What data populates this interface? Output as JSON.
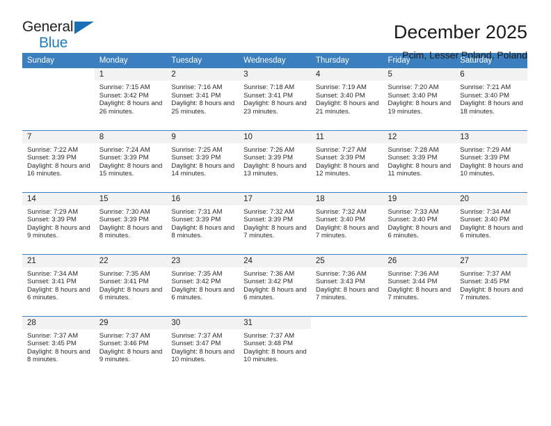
{
  "brand": {
    "name_part1": "General",
    "name_part2": "Blue",
    "flag_icon": "triangle-flag-icon",
    "accent_color": "#1a7fc1"
  },
  "header": {
    "title": "December 2025",
    "subtitle": "Pcim, Lesser Poland, Poland"
  },
  "calendar": {
    "header_bg_color": "#3b7fbe",
    "daynum_bg_color": "#f2f2f2",
    "weekday_headers": [
      "Sunday",
      "Monday",
      "Tuesday",
      "Wednesday",
      "Thursday",
      "Friday",
      "Saturday"
    ],
    "weeks": [
      [
        {
          "day": "",
          "sunrise": "",
          "sunset": "",
          "daylight": ""
        },
        {
          "day": "1",
          "sunrise": "Sunrise: 7:15 AM",
          "sunset": "Sunset: 3:42 PM",
          "daylight": "Daylight: 8 hours and 26 minutes."
        },
        {
          "day": "2",
          "sunrise": "Sunrise: 7:16 AM",
          "sunset": "Sunset: 3:41 PM",
          "daylight": "Daylight: 8 hours and 25 minutes."
        },
        {
          "day": "3",
          "sunrise": "Sunrise: 7:18 AM",
          "sunset": "Sunset: 3:41 PM",
          "daylight": "Daylight: 8 hours and 23 minutes."
        },
        {
          "day": "4",
          "sunrise": "Sunrise: 7:19 AM",
          "sunset": "Sunset: 3:40 PM",
          "daylight": "Daylight: 8 hours and 21 minutes."
        },
        {
          "day": "5",
          "sunrise": "Sunrise: 7:20 AM",
          "sunset": "Sunset: 3:40 PM",
          "daylight": "Daylight: 8 hours and 19 minutes."
        },
        {
          "day": "6",
          "sunrise": "Sunrise: 7:21 AM",
          "sunset": "Sunset: 3:40 PM",
          "daylight": "Daylight: 8 hours and 18 minutes."
        }
      ],
      [
        {
          "day": "7",
          "sunrise": "Sunrise: 7:22 AM",
          "sunset": "Sunset: 3:39 PM",
          "daylight": "Daylight: 8 hours and 16 minutes."
        },
        {
          "day": "8",
          "sunrise": "Sunrise: 7:24 AM",
          "sunset": "Sunset: 3:39 PM",
          "daylight": "Daylight: 8 hours and 15 minutes."
        },
        {
          "day": "9",
          "sunrise": "Sunrise: 7:25 AM",
          "sunset": "Sunset: 3:39 PM",
          "daylight": "Daylight: 8 hours and 14 minutes."
        },
        {
          "day": "10",
          "sunrise": "Sunrise: 7:26 AM",
          "sunset": "Sunset: 3:39 PM",
          "daylight": "Daylight: 8 hours and 13 minutes."
        },
        {
          "day": "11",
          "sunrise": "Sunrise: 7:27 AM",
          "sunset": "Sunset: 3:39 PM",
          "daylight": "Daylight: 8 hours and 12 minutes."
        },
        {
          "day": "12",
          "sunrise": "Sunrise: 7:28 AM",
          "sunset": "Sunset: 3:39 PM",
          "daylight": "Daylight: 8 hours and 11 minutes."
        },
        {
          "day": "13",
          "sunrise": "Sunrise: 7:29 AM",
          "sunset": "Sunset: 3:39 PM",
          "daylight": "Daylight: 8 hours and 10 minutes."
        }
      ],
      [
        {
          "day": "14",
          "sunrise": "Sunrise: 7:29 AM",
          "sunset": "Sunset: 3:39 PM",
          "daylight": "Daylight: 8 hours and 9 minutes."
        },
        {
          "day": "15",
          "sunrise": "Sunrise: 7:30 AM",
          "sunset": "Sunset: 3:39 PM",
          "daylight": "Daylight: 8 hours and 8 minutes."
        },
        {
          "day": "16",
          "sunrise": "Sunrise: 7:31 AM",
          "sunset": "Sunset: 3:39 PM",
          "daylight": "Daylight: 8 hours and 8 minutes."
        },
        {
          "day": "17",
          "sunrise": "Sunrise: 7:32 AM",
          "sunset": "Sunset: 3:39 PM",
          "daylight": "Daylight: 8 hours and 7 minutes."
        },
        {
          "day": "18",
          "sunrise": "Sunrise: 7:32 AM",
          "sunset": "Sunset: 3:40 PM",
          "daylight": "Daylight: 8 hours and 7 minutes."
        },
        {
          "day": "19",
          "sunrise": "Sunrise: 7:33 AM",
          "sunset": "Sunset: 3:40 PM",
          "daylight": "Daylight: 8 hours and 6 minutes."
        },
        {
          "day": "20",
          "sunrise": "Sunrise: 7:34 AM",
          "sunset": "Sunset: 3:40 PM",
          "daylight": "Daylight: 8 hours and 6 minutes."
        }
      ],
      [
        {
          "day": "21",
          "sunrise": "Sunrise: 7:34 AM",
          "sunset": "Sunset: 3:41 PM",
          "daylight": "Daylight: 8 hours and 6 minutes."
        },
        {
          "day": "22",
          "sunrise": "Sunrise: 7:35 AM",
          "sunset": "Sunset: 3:41 PM",
          "daylight": "Daylight: 8 hours and 6 minutes."
        },
        {
          "day": "23",
          "sunrise": "Sunrise: 7:35 AM",
          "sunset": "Sunset: 3:42 PM",
          "daylight": "Daylight: 8 hours and 6 minutes."
        },
        {
          "day": "24",
          "sunrise": "Sunrise: 7:36 AM",
          "sunset": "Sunset: 3:42 PM",
          "daylight": "Daylight: 8 hours and 6 minutes."
        },
        {
          "day": "25",
          "sunrise": "Sunrise: 7:36 AM",
          "sunset": "Sunset: 3:43 PM",
          "daylight": "Daylight: 8 hours and 7 minutes."
        },
        {
          "day": "26",
          "sunrise": "Sunrise: 7:36 AM",
          "sunset": "Sunset: 3:44 PM",
          "daylight": "Daylight: 8 hours and 7 minutes."
        },
        {
          "day": "27",
          "sunrise": "Sunrise: 7:37 AM",
          "sunset": "Sunset: 3:45 PM",
          "daylight": "Daylight: 8 hours and 7 minutes."
        }
      ],
      [
        {
          "day": "28",
          "sunrise": "Sunrise: 7:37 AM",
          "sunset": "Sunset: 3:45 PM",
          "daylight": "Daylight: 8 hours and 8 minutes."
        },
        {
          "day": "29",
          "sunrise": "Sunrise: 7:37 AM",
          "sunset": "Sunset: 3:46 PM",
          "daylight": "Daylight: 8 hours and 9 minutes."
        },
        {
          "day": "30",
          "sunrise": "Sunrise: 7:37 AM",
          "sunset": "Sunset: 3:47 PM",
          "daylight": "Daylight: 8 hours and 10 minutes."
        },
        {
          "day": "31",
          "sunrise": "Sunrise: 7:37 AM",
          "sunset": "Sunset: 3:48 PM",
          "daylight": "Daylight: 8 hours and 10 minutes."
        },
        {
          "day": "",
          "sunrise": "",
          "sunset": "",
          "daylight": ""
        },
        {
          "day": "",
          "sunrise": "",
          "sunset": "",
          "daylight": ""
        },
        {
          "day": "",
          "sunrise": "",
          "sunset": "",
          "daylight": ""
        }
      ]
    ]
  }
}
